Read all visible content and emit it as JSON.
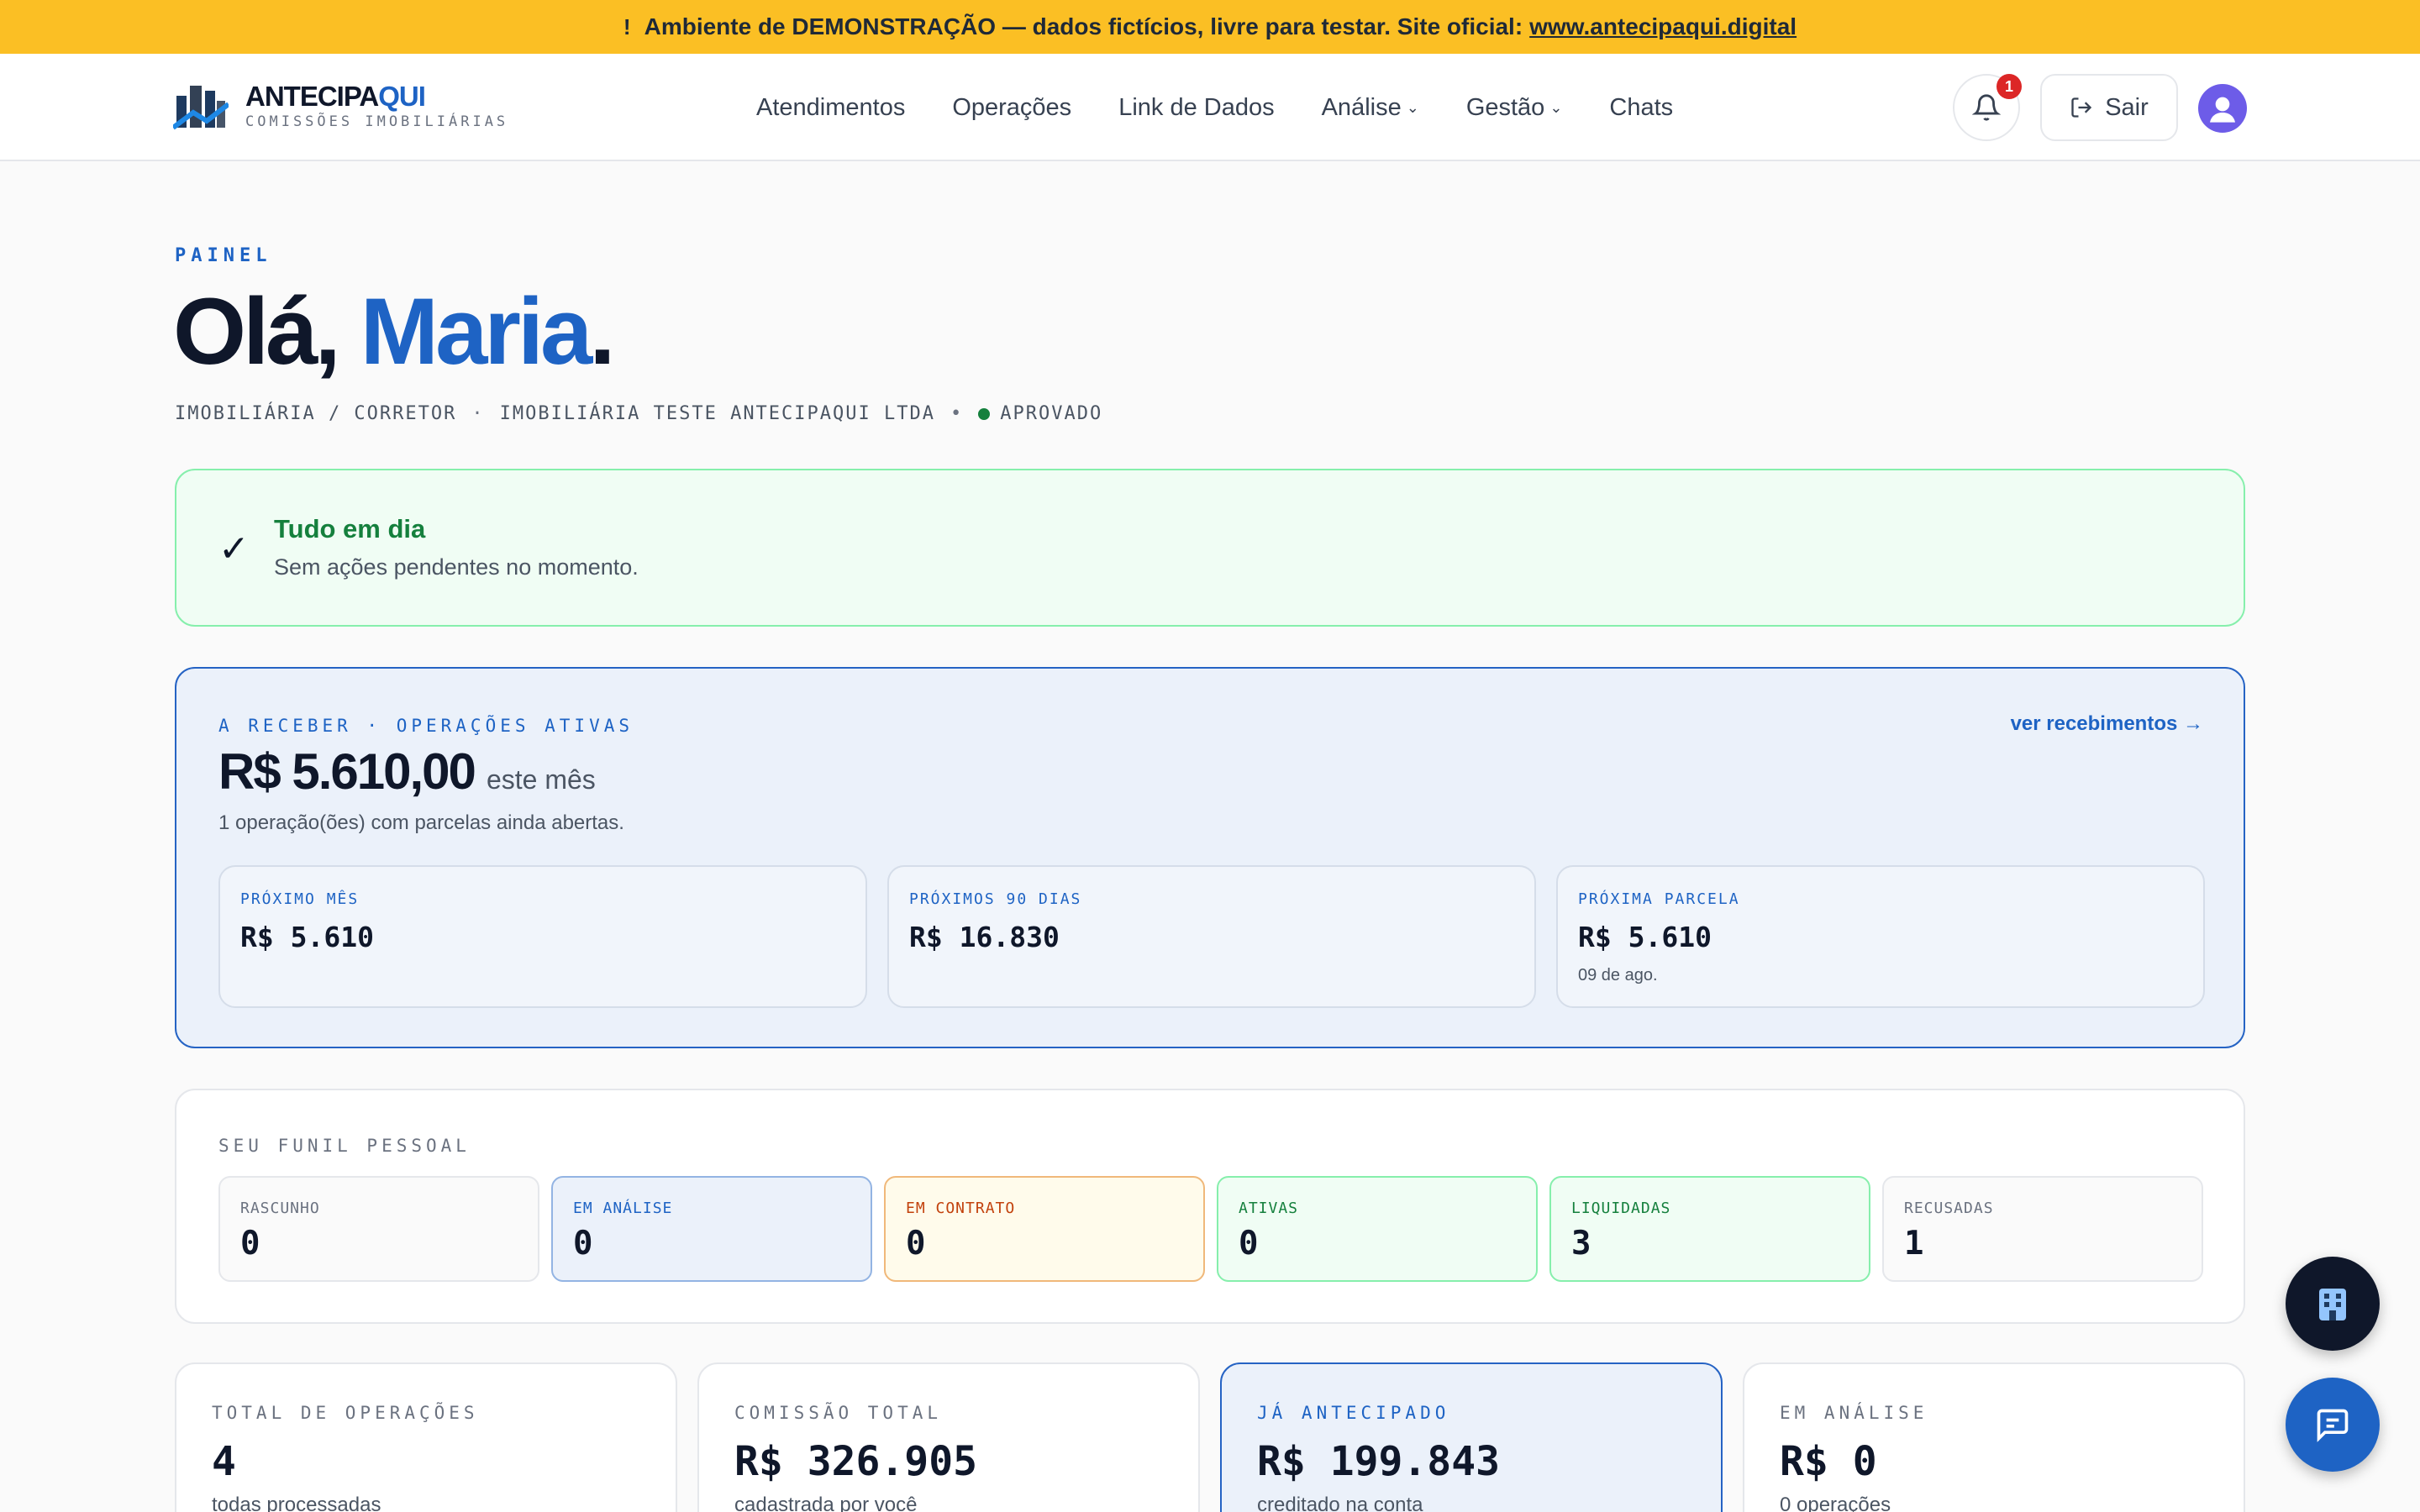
{
  "banner": {
    "icon": "warning-icon",
    "text": "Ambiente de DEMONSTRAÇÃO — dados fictícios, livre para testar. Site oficial:",
    "link": "www.antecipaqui.digital"
  },
  "brand": {
    "name_main": "ANTECIPA",
    "name_accent": "QUI",
    "tagline": "COMISSÕES IMOBILIÁRIAS"
  },
  "nav": {
    "items": [
      "Atendimentos",
      "Operações",
      "Link de Dados",
      "Análise",
      "Gestão",
      "Chats"
    ],
    "notification_count": "1",
    "logout_label": "Sair"
  },
  "header": {
    "eyebrow": "PAINEL",
    "greeting": "Olá,",
    "name": "Maria",
    "period": ".",
    "role": "IMOBILIÁRIA / CORRETOR",
    "separator": "·",
    "company": "IMOBILIÁRIA TESTE ANTECIPAQUI LTDA",
    "bullet": "•",
    "status": "APROVADO"
  },
  "alert": {
    "title": "Tudo em dia",
    "message": "Sem ações pendentes no momento."
  },
  "receivables": {
    "eyebrow": "A RECEBER · OPERAÇÕES ATIVAS",
    "link": "ver recebimentos →",
    "amount": "R$ 5.610,00",
    "amount_suffix": "este mês",
    "description": "1 operação(ões) com parcelas ainda abertas.",
    "cards": [
      {
        "label": "PRÓXIMO MÊS",
        "value": "R$ 5.610",
        "detail": ""
      },
      {
        "label": "PRÓXIMOS 90 DIAS",
        "value": "R$ 16.830",
        "detail": ""
      },
      {
        "label": "PRÓXIMA PARCELA",
        "value": "R$ 5.610",
        "detail": "09 de ago."
      }
    ]
  },
  "funnel": {
    "eyebrow": "SEU FUNIL PESSOAL",
    "stages": [
      {
        "label": "RASCUNHO",
        "value": "0"
      },
      {
        "label": "EM ANÁLISE",
        "value": "0"
      },
      {
        "label": "EM CONTRATO",
        "value": "0"
      },
      {
        "label": "ATIVAS",
        "value": "0"
      },
      {
        "label": "LIQUIDADAS",
        "value": "3"
      },
      {
        "label": "RECUSADAS",
        "value": "1"
      }
    ]
  },
  "stats": [
    {
      "label": "TOTAL DE OPERAÇÕES",
      "value": "4",
      "detail": "todas processadas"
    },
    {
      "label": "COMISSÃO TOTAL",
      "value": "R$ 326.905",
      "detail": "cadastrada por você"
    },
    {
      "label": "JÁ ANTECIPADO",
      "value": "R$ 199.843",
      "detail": "creditado na conta"
    },
    {
      "label": "EM ANÁLISE",
      "value": "R$ 0",
      "detail": "0 operações"
    }
  ],
  "colors": {
    "accent": "#1e63c4",
    "banner": "#fbbf24",
    "success": "#15803d",
    "danger": "#dc2626"
  }
}
